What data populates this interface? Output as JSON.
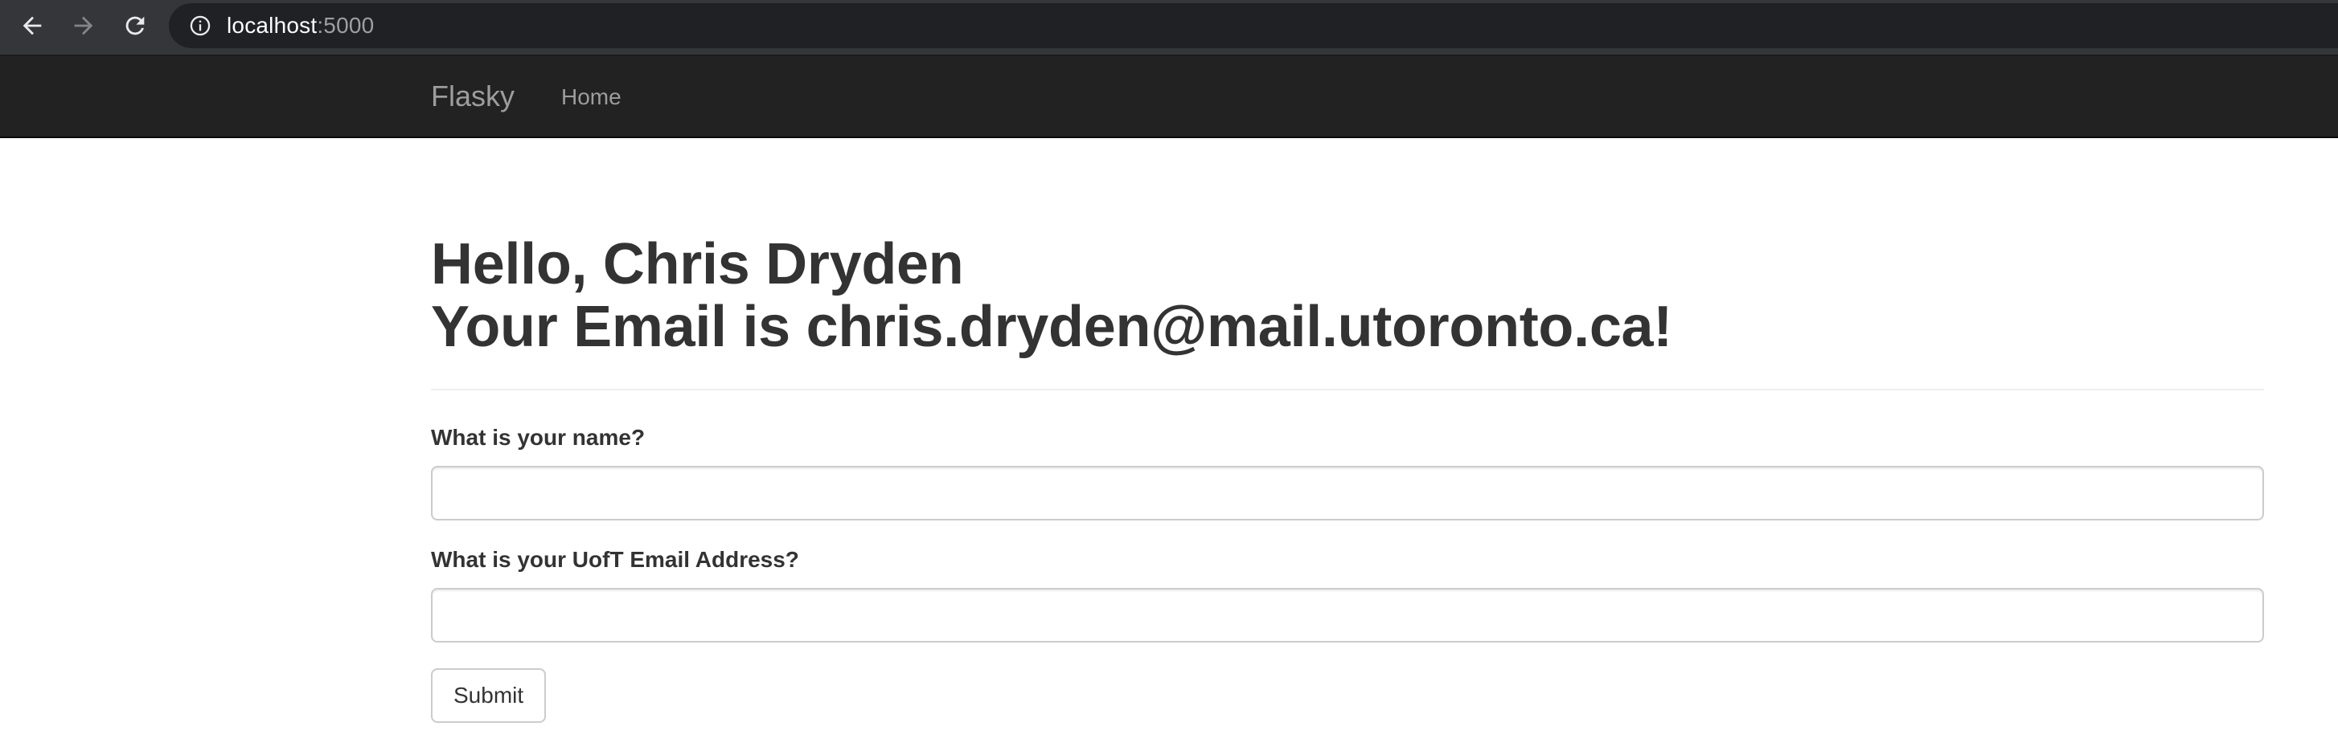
{
  "browser": {
    "url_host": "localhost",
    "url_port": ":5000",
    "icons": {
      "back": "arrow-left-icon",
      "forward": "arrow-right-icon",
      "reload": "reload-icon",
      "site_info": "info-icon"
    }
  },
  "navbar": {
    "brand": "Flasky",
    "links": [
      "Home"
    ]
  },
  "header": {
    "greeting": "Hello, Chris Dryden",
    "email_line": "Your Email is chris.dryden@mail.utoronto.ca!"
  },
  "form": {
    "name_label": "What is your name?",
    "name_value": "",
    "email_label": "What is your UofT Email Address?",
    "email_value": "",
    "submit_label": "Submit"
  },
  "colors": {
    "navbar_bg": "#222222",
    "nav_text": "#9d9d9d",
    "heading_text": "#333333",
    "chrome_bg": "#35363a",
    "omnibox_bg": "#202124"
  }
}
